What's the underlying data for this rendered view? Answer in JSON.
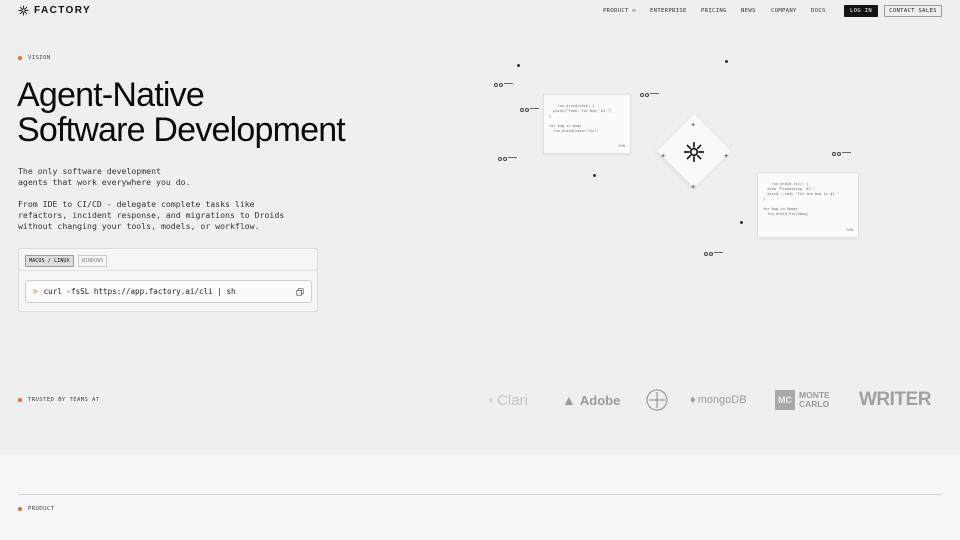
{
  "header": {
    "brand": "FACTORY",
    "nav": [
      "PRODUCT >",
      "ENTERPRISE",
      "PRICING",
      "NEWS",
      "COMPANY",
      "DOCS"
    ],
    "login": "LOG IN",
    "contact": "CONTACT SALES"
  },
  "hero": {
    "eyebrow": "VISION",
    "title_line1": "Agent-Native",
    "title_line2": "Software Development",
    "subtitle": "The only software development\nagents that work everywhere you do.",
    "body": "From IDE to CI/CD - delegate complete tasks like\nrefactors, incident response, and migrations to Droids\nwithout changing your tools, models, or workflow."
  },
  "installer": {
    "tabs": [
      "MACOS / LINUX",
      "WINDOWS"
    ],
    "active_tab": "MACOS / LINUX",
    "prompt": ">",
    "command": "curl -fsSL https://app.factory.ai/cli | sh"
  },
  "trusted": {
    "label": "TRUSTED BY TEAMS AT",
    "logos": [
      "Clari",
      "Adobe",
      "Bayer",
      "mongoDB",
      "MONTE CARLO",
      "WRITER"
    ]
  },
  "product": {
    "label": "PRODUCT"
  },
  "diagram": {
    "card1_code": "run_droid(task) {\n  print(\"Task: Fix bug '$1'\")\n}\n\nfor bug in bugs\n  run_droid(task=\"fix\")",
    "card1_run": "RUN",
    "card2_code": "run_droid_fix() {\n  echo \"Processing '$1'\"\n  droid --task \"Fix the bug in $1.\"\n}\n\nfor bug in $bugs\n  run_droid_fix($bug)",
    "card2_run": "RUN"
  },
  "colors": {
    "accent": "#ee6a2d",
    "dark": "#141414",
    "background": "#efefef"
  }
}
